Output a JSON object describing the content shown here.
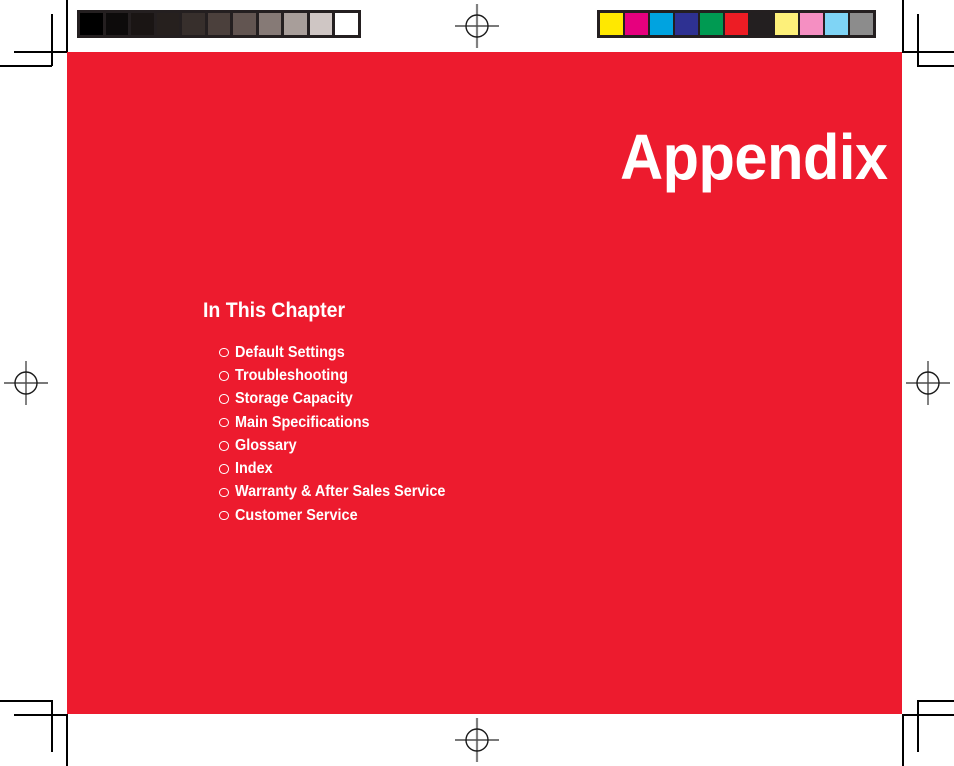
{
  "page": {
    "background_color": "#ffffff",
    "panel_color": "#ed1b2e",
    "text_color": "#ffffff"
  },
  "chapter": {
    "title": "Appendix",
    "in_this_chapter_heading": "In This Chapter",
    "items": [
      {
        "label": "Default Settings",
        "bullet": "hollow-circle-bullet"
      },
      {
        "label": "Troubleshooting",
        "bullet": "hollow-circle-bullet"
      },
      {
        "label": "Storage Capacity",
        "bullet": "hollow-circle-bullet"
      },
      {
        "label": "Main Specifications",
        "bullet": "hollow-circle-bullet"
      },
      {
        "label": "Glossary",
        "bullet": "hollow-circle-bullet"
      },
      {
        "label": "Index",
        "bullet": "hollow-circle-bullet"
      },
      {
        "label": "Warranty & After Sales Service",
        "bullet": "hollow-circle-bullet"
      },
      {
        "label": "Customer Service",
        "bullet": "hollow-circle-bullet"
      }
    ]
  },
  "print_calibration": {
    "grayscale_bar": {
      "name": "grayscale-calibration-bar",
      "frame_color": "#241f20",
      "swatches": [
        "#000000",
        "#0d0b0b",
        "#1a1514",
        "#26201e",
        "#372f2c",
        "#4b403c",
        "#625551",
        "#867a76",
        "#a89e9a",
        "#cfc6c4",
        "#ffffff"
      ]
    },
    "color_bar": {
      "name": "color-calibration-bar",
      "frame_color": "#241f20",
      "swatches": [
        "#ffe800",
        "#e6007e",
        "#00a3e0",
        "#2e3192",
        "#009a52",
        "#ed1c24",
        "#231f20",
        "#fdf07a",
        "#f58fc2",
        "#7fd4f5",
        "#8c8c8c"
      ]
    }
  },
  "press_marks": {
    "registration_mark_label": "registration-mark",
    "crop_mark_label": "crop-mark"
  }
}
